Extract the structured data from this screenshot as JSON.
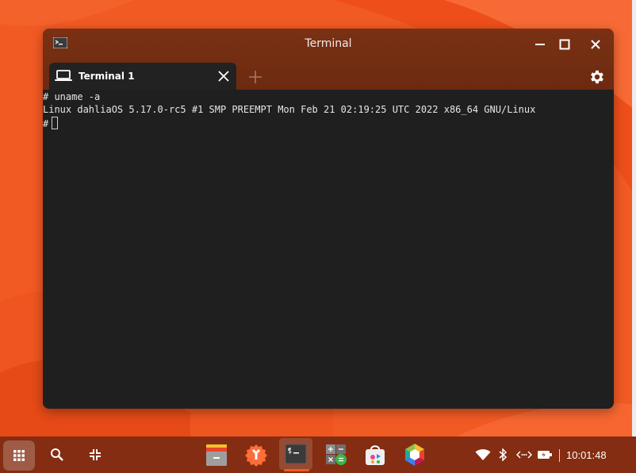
{
  "window": {
    "title": "Terminal",
    "controls": [
      "minimize-icon",
      "maximize-icon",
      "close-icon"
    ]
  },
  "tabs": [
    {
      "label": "Terminal 1",
      "icon": "laptop-icon",
      "active": true
    }
  ],
  "terminal": {
    "lines": [
      "# uname -a",
      "Linux dahliaOS 5.17.0-rc5 #1 SMP PREEMPT Mon Feb 21 02:19:25 UTC 2022 x86_64 GNU/Linux",
      "#"
    ]
  },
  "taskbar": {
    "apps": [
      "files-icon",
      "settings-app-icon",
      "terminal-icon",
      "calculator-icon",
      "store-icon",
      "graft-icon"
    ],
    "active_app": "terminal-icon",
    "tray": [
      "wifi-icon",
      "bluetooth-icon",
      "network-icon",
      "battery-icon"
    ],
    "clock": "10:01:48"
  },
  "colors": {
    "accent": "#f25a24",
    "titlebar": "#6c2a10",
    "taskbar": "#842d12",
    "terminal_bg": "#1f1f1f"
  }
}
